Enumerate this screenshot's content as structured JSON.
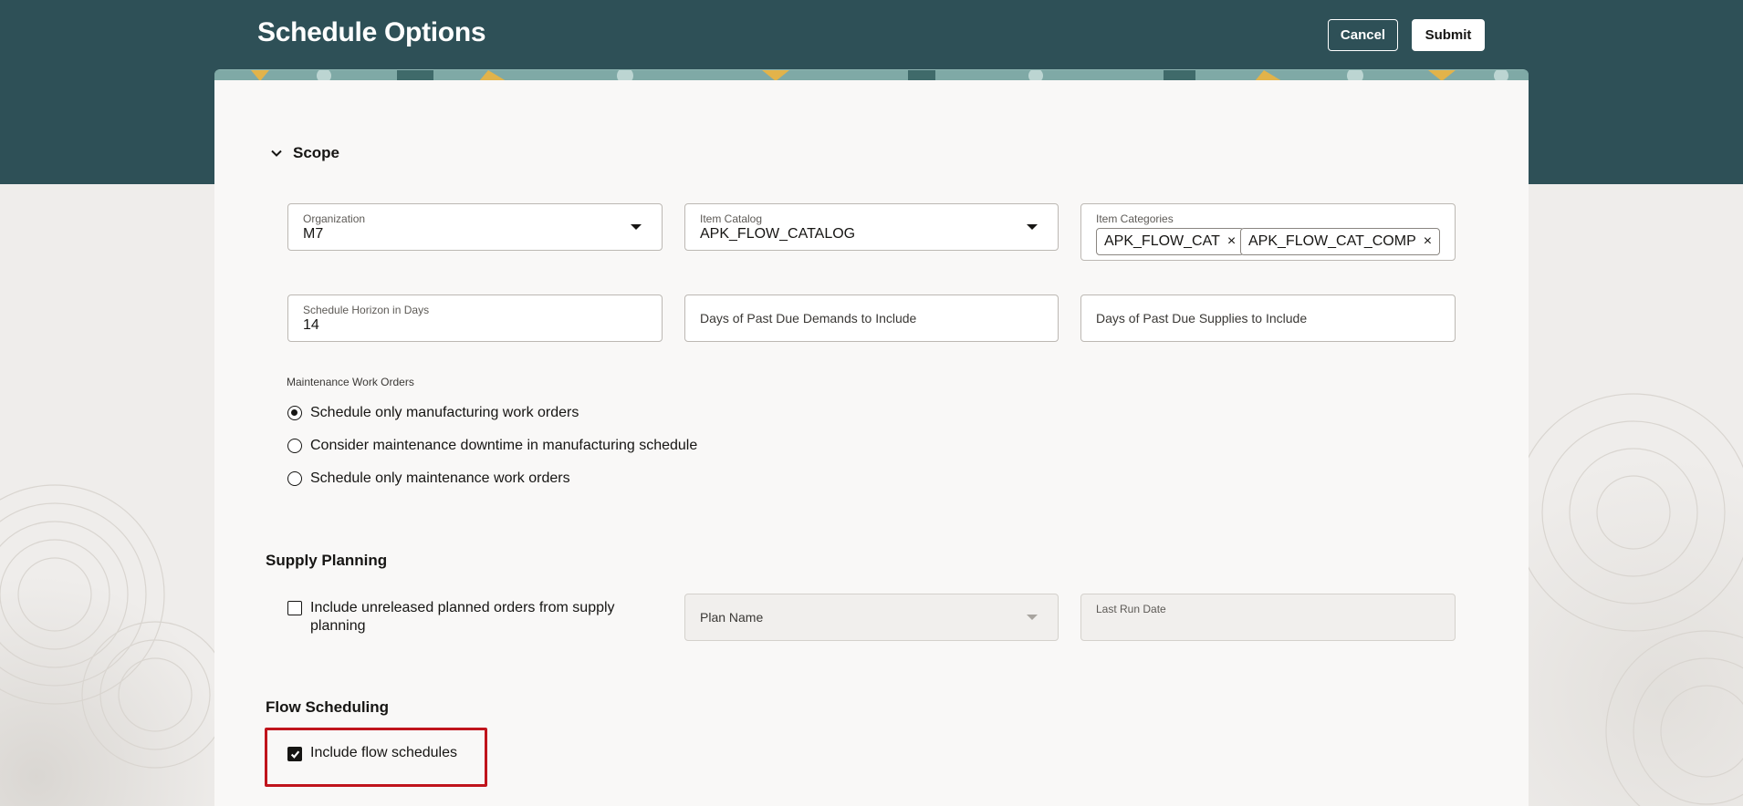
{
  "header": {
    "title": "Schedule Options",
    "cancel_label": "Cancel",
    "submit_label": "Submit"
  },
  "scope": {
    "title": "Scope",
    "organization": {
      "label": "Organization",
      "value": "M7"
    },
    "item_catalog": {
      "label": "Item Catalog",
      "value": "APK_FLOW_CATALOG"
    },
    "item_categories": {
      "label": "Item Categories",
      "chips": [
        "APK_FLOW_CAT",
        "APK_FLOW_CAT_COMP"
      ]
    },
    "horizon": {
      "label": "Schedule Horizon in Days",
      "value": "14"
    },
    "past_due_demands": {
      "placeholder": "Days of Past Due Demands to Include"
    },
    "past_due_supplies": {
      "placeholder": "Days of Past Due Supplies to Include"
    },
    "maintenance": {
      "label": "Maintenance Work Orders",
      "options": [
        "Schedule only manufacturing work orders",
        "Consider maintenance downtime in manufacturing schedule",
        "Schedule only maintenance work orders"
      ],
      "selected_index": 0
    }
  },
  "supply_planning": {
    "title": "Supply Planning",
    "include_unreleased": {
      "label_line1": "Include unreleased planned orders from supply",
      "label_line2": "planning",
      "checked": false
    },
    "plan_name": {
      "placeholder": "Plan Name"
    },
    "last_run_date": {
      "label": "Last Run Date",
      "value": ""
    }
  },
  "flow_scheduling": {
    "title": "Flow Scheduling",
    "include_flow": {
      "label": "Include flow schedules",
      "checked": true
    }
  },
  "colors": {
    "header_bg": "#2e5057",
    "highlight": "#c0141c"
  }
}
